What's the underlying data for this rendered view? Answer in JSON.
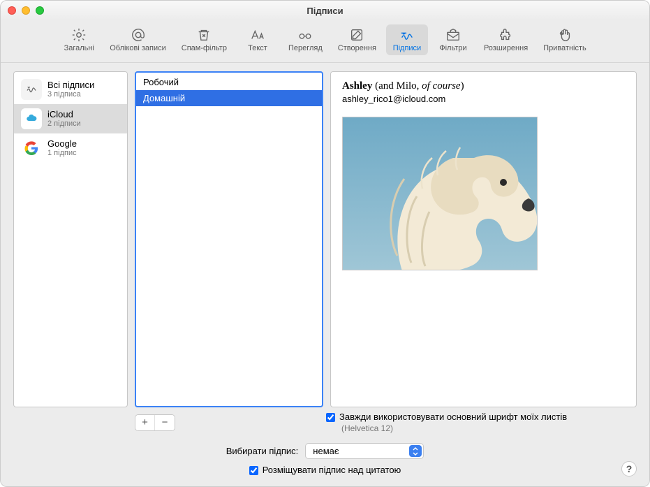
{
  "window": {
    "title": "Підписи"
  },
  "toolbar": {
    "items": [
      {
        "label": "Загальні"
      },
      {
        "label": "Облікові записи"
      },
      {
        "label": "Спам-фільтр"
      },
      {
        "label": "Текст"
      },
      {
        "label": "Перегляд"
      },
      {
        "label": "Створення"
      },
      {
        "label": "Підписи"
      },
      {
        "label": "Фільтри"
      },
      {
        "label": "Розширення"
      },
      {
        "label": "Приватність"
      }
    ]
  },
  "accounts": [
    {
      "name": "Всі підписи",
      "sub": "3 підписа"
    },
    {
      "name": "iCloud",
      "sub": "2 підписи"
    },
    {
      "name": "Google",
      "sub": "1 підпис"
    }
  ],
  "signatures": [
    {
      "label": "Робочий"
    },
    {
      "label": "Домашній"
    }
  ],
  "preview": {
    "name_bold": "Ashley",
    "name_rest": " (and Milo, ",
    "name_italic": "of course",
    "name_after": ")",
    "email": "ashley_rico1@icloud.com"
  },
  "options": {
    "always_font_label": "Завжди використовувати основний шрифт моїх листів",
    "font_hint": "(Helvetica 12)",
    "choose_label": "Вибирати підпис:",
    "choose_value": "немає",
    "above_quote_label": "Розміщувати підпис над цитатою"
  },
  "help": {
    "glyph": "?"
  },
  "buttons": {
    "plus": "+",
    "minus": "−"
  }
}
